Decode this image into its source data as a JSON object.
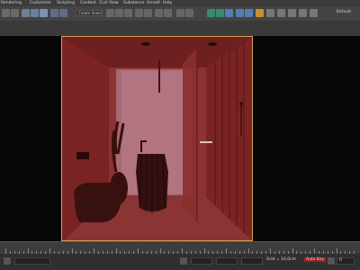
{
  "menu": [
    {
      "label": "Rendering"
    },
    {
      "label": "Customize"
    },
    {
      "label": "Scripting"
    },
    {
      "label": "Content"
    },
    {
      "label": "Civil View"
    },
    {
      "label": "Substance"
    },
    {
      "label": "Arnold"
    },
    {
      "label": "Help"
    }
  ],
  "toolbar": {
    "named_selection": "Create Selection Se",
    "right_label": "Default"
  },
  "status": {
    "grid_label": "Grid = 10,0cm",
    "auto_key": "Auto Key",
    "frame_value": "0"
  },
  "colors": {
    "scene_wall": "#7d2525",
    "scene_highlight": "#a86a72",
    "selection_border": "#d9a050",
    "menubar": "#3c3c3c",
    "toolbar": "#444444"
  },
  "icons": [
    "undo-icon",
    "redo-icon",
    "link-icon",
    "unlink-icon",
    "bind-icon",
    "select-icon",
    "region-icon",
    "move-icon",
    "rotate-icon",
    "scale-icon",
    "snap-icon",
    "angle-snap-icon",
    "mirror-icon",
    "align-icon",
    "layer-icon",
    "render-icon",
    "teapot-icon"
  ]
}
